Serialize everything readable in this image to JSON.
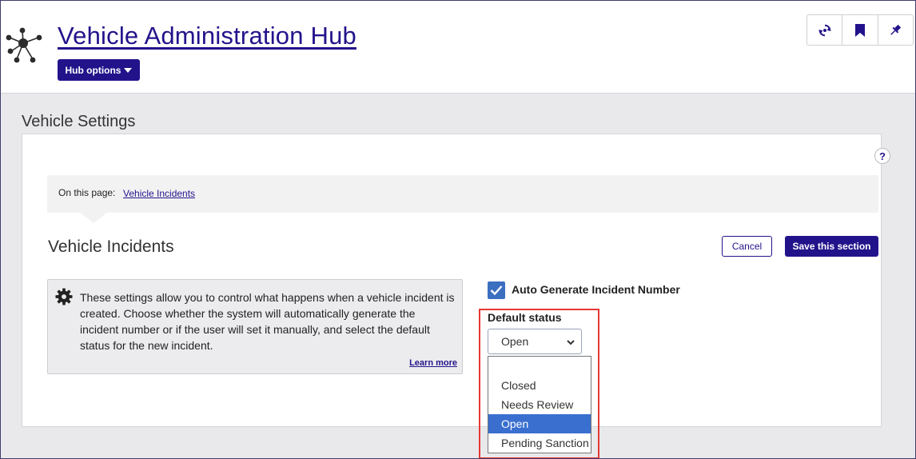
{
  "header": {
    "title": "Vehicle Administration Hub",
    "hub_options_label": "Hub options",
    "tools": [
      {
        "icon": "sync-icon"
      },
      {
        "icon": "bookmark-icon"
      },
      {
        "icon": "pin-icon"
      }
    ]
  },
  "section": {
    "title": "Vehicle Settings",
    "help_label": "?"
  },
  "on_this_page": {
    "label": "On this page:",
    "link": "Vehicle Incidents"
  },
  "incidents": {
    "title": "Vehicle Incidents",
    "cancel_label": "Cancel",
    "save_label": "Save this section",
    "info_text": "These settings allow you to control what happens when a vehicle incident is created. Choose whether the system will automatically generate the incident number or if the user will set it manually, and select the default status for the new incident.",
    "learn_more": "Learn more",
    "auto_generate_label": "Auto Generate Incident Number",
    "auto_generate_checked": true,
    "default_status_label": "Default status",
    "default_status_value": "Open",
    "status_options": [
      "",
      "Closed",
      "Needs Review",
      "Open",
      "Pending Sanction"
    ],
    "selected_option_index": 3
  },
  "colors": {
    "brand": "#23138b",
    "selected_option": "#3a6fcf",
    "highlight": "#e53935",
    "checkbox": "#3b6fc0"
  }
}
